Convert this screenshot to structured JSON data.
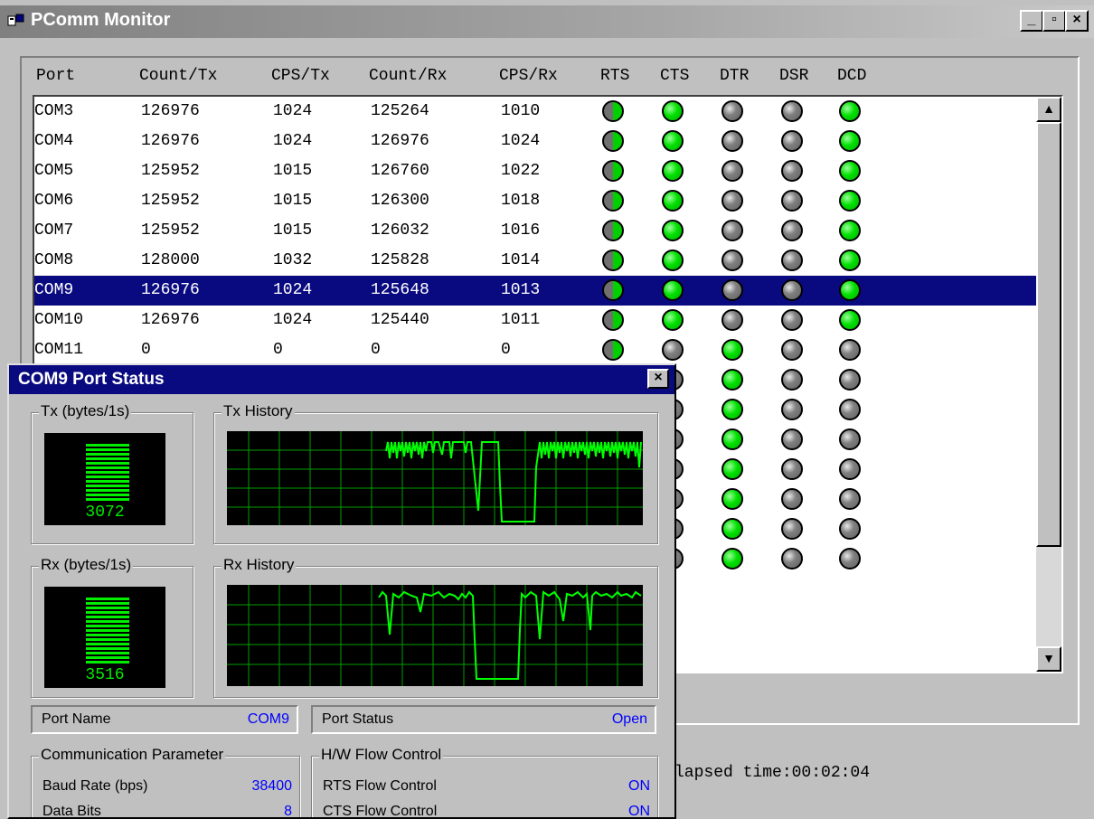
{
  "window": {
    "title": "PComm Monitor",
    "minimize": "_",
    "restore": "▫",
    "close": "×"
  },
  "columns": [
    "Port",
    "Count/Tx",
    "CPS/Tx",
    "Count/Rx",
    "CPS/Rx",
    "RTS",
    "CTS",
    "DTR",
    "DSR",
    "DCD"
  ],
  "rows": [
    {
      "port": "COM3",
      "count_tx": "126976",
      "cps_tx": "1024",
      "count_rx": "125264",
      "cps_rx": "1010",
      "rts": "half",
      "cts": "on",
      "dtr": "off",
      "dsr": "off",
      "dcd": "on"
    },
    {
      "port": "COM4",
      "count_tx": "126976",
      "cps_tx": "1024",
      "count_rx": "126976",
      "cps_rx": "1024",
      "rts": "half",
      "cts": "on",
      "dtr": "off",
      "dsr": "off",
      "dcd": "on"
    },
    {
      "port": "COM5",
      "count_tx": "125952",
      "cps_tx": "1015",
      "count_rx": "126760",
      "cps_rx": "1022",
      "rts": "half",
      "cts": "on",
      "dtr": "off",
      "dsr": "off",
      "dcd": "on"
    },
    {
      "port": "COM6",
      "count_tx": "125952",
      "cps_tx": "1015",
      "count_rx": "126300",
      "cps_rx": "1018",
      "rts": "half",
      "cts": "on",
      "dtr": "off",
      "dsr": "off",
      "dcd": "on"
    },
    {
      "port": "COM7",
      "count_tx": "125952",
      "cps_tx": "1015",
      "count_rx": "126032",
      "cps_rx": "1016",
      "rts": "half",
      "cts": "on",
      "dtr": "off",
      "dsr": "off",
      "dcd": "on"
    },
    {
      "port": "COM8",
      "count_tx": "128000",
      "cps_tx": "1032",
      "count_rx": "125828",
      "cps_rx": "1014",
      "rts": "half",
      "cts": "on",
      "dtr": "off",
      "dsr": "off",
      "dcd": "on"
    },
    {
      "port": "COM9",
      "count_tx": "126976",
      "cps_tx": "1024",
      "count_rx": "125648",
      "cps_rx": "1013",
      "rts": "half",
      "cts": "on",
      "dtr": "off",
      "dsr": "off",
      "dcd": "on",
      "selected": true
    },
    {
      "port": "COM10",
      "count_tx": "126976",
      "cps_tx": "1024",
      "count_rx": "125440",
      "cps_rx": "1011",
      "rts": "half",
      "cts": "on",
      "dtr": "off",
      "dsr": "off",
      "dcd": "on"
    },
    {
      "port": "COM11",
      "count_tx": "0",
      "cps_tx": "0",
      "count_rx": "0",
      "cps_rx": "0",
      "rts": "half",
      "cts": "off",
      "dtr": "on",
      "dsr": "off",
      "dcd": "off"
    },
    {
      "port": "",
      "count_tx": "",
      "cps_tx": "",
      "count_rx": "",
      "cps_rx": "",
      "rts": "off",
      "cts": "off",
      "dtr": "on",
      "dsr": "off",
      "dcd": "off"
    },
    {
      "port": "",
      "count_tx": "",
      "cps_tx": "",
      "count_rx": "",
      "cps_rx": "",
      "rts": "off",
      "cts": "off",
      "dtr": "on",
      "dsr": "off",
      "dcd": "off"
    },
    {
      "port": "",
      "count_tx": "",
      "cps_tx": "",
      "count_rx": "",
      "cps_rx": "",
      "rts": "off",
      "cts": "off",
      "dtr": "on",
      "dsr": "off",
      "dcd": "off"
    },
    {
      "port": "",
      "count_tx": "",
      "cps_tx": "",
      "count_rx": "",
      "cps_rx": "",
      "rts": "off",
      "cts": "off",
      "dtr": "on",
      "dsr": "off",
      "dcd": "off"
    },
    {
      "port": "",
      "count_tx": "",
      "cps_tx": "",
      "count_rx": "",
      "cps_rx": "",
      "rts": "off",
      "cts": "off",
      "dtr": "on",
      "dsr": "off",
      "dcd": "off"
    },
    {
      "port": "",
      "count_tx": "",
      "cps_tx": "",
      "count_rx": "",
      "cps_rx": "",
      "rts": "off",
      "cts": "off",
      "dtr": "on",
      "dsr": "off",
      "dcd": "off"
    },
    {
      "port": "",
      "count_tx": "",
      "cps_tx": "",
      "count_rx": "",
      "cps_rx": "",
      "rts": "off",
      "cts": "off",
      "dtr": "on",
      "dsr": "off",
      "dcd": "off"
    }
  ],
  "status": {
    "elapsed": "lapsed time:00:02:04"
  },
  "dialog": {
    "title": "COM9 Port Status",
    "close": "×",
    "tx_label": "Tx (bytes/1s)",
    "tx_value": "3072",
    "tx_history_label": "Tx History",
    "rx_label": "Rx (bytes/1s)",
    "rx_value": "3516",
    "rx_history_label": "Rx History",
    "port_name_label": "Port Name",
    "port_name_value": "COM9",
    "port_status_label": "Port Status",
    "port_status_value": "Open",
    "comm_group_label": "Communication Parameter",
    "baud_label": "Baud Rate (bps)",
    "baud_value": "38400",
    "databits_label": "Data Bits",
    "databits_value": "8",
    "flow_group_label": "H/W Flow Control",
    "rts_flow_label": "RTS Flow Control",
    "rts_flow_value": "ON",
    "cts_flow_label": "CTS Flow Control",
    "cts_flow_value": "ON"
  },
  "colors": {
    "led_on": "#00e000",
    "led_off": "#808080",
    "selection": "#0a0a80",
    "value_blue": "#0000ff",
    "meter_green": "#00ee00"
  }
}
